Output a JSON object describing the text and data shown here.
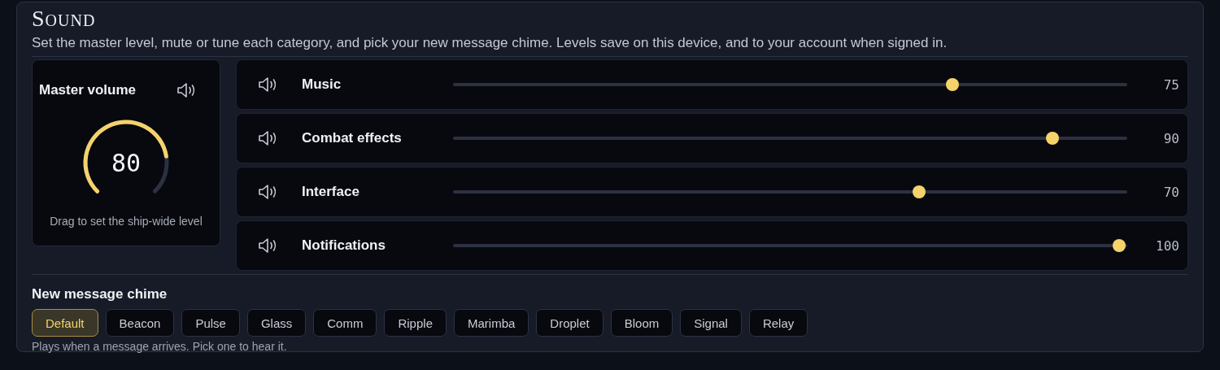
{
  "panel": {
    "title": "Sound",
    "description": "Set the master level, mute or tune each category, and pick your new message chime. Levels save on this device, and to your account when signed in."
  },
  "master": {
    "label": "Master volume",
    "value": "80",
    "hint": "Drag to set the ship-wide level"
  },
  "channels": [
    {
      "name": "Music",
      "level": 0.75,
      "reading": "75"
    },
    {
      "name": "Combat effects",
      "level": 0.9,
      "reading": "90"
    },
    {
      "name": "Interface",
      "level": 0.7,
      "reading": "70"
    },
    {
      "name": "Notifications",
      "level": 1,
      "reading": "100"
    }
  ],
  "chime": {
    "label": "New message chime",
    "options": [
      {
        "label": "Default",
        "selected": true
      },
      {
        "label": "Beacon",
        "selected": false
      },
      {
        "label": "Pulse",
        "selected": false
      },
      {
        "label": "Glass",
        "selected": false
      },
      {
        "label": "Comm",
        "selected": false
      },
      {
        "label": "Ripple",
        "selected": false
      },
      {
        "label": "Marimba",
        "selected": false
      },
      {
        "label": "Droplet",
        "selected": false
      },
      {
        "label": "Bloom",
        "selected": false
      },
      {
        "label": "Signal",
        "selected": false
      },
      {
        "label": "Relay",
        "selected": false
      }
    ],
    "hint": "Plays when a message arrives. Pick one to hear it."
  }
}
